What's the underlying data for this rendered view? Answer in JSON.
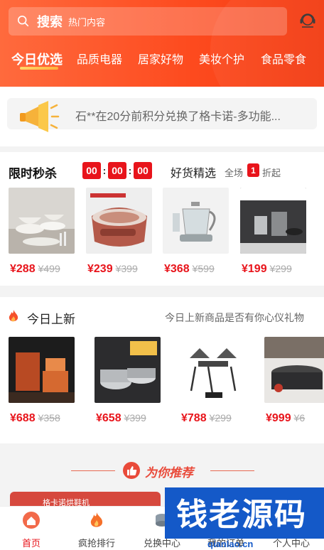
{
  "header": {
    "search_label": "搜索",
    "search_placeholder": "热门内容",
    "tabs": [
      "今日优选",
      "品质电器",
      "居家好物",
      "美妆个护",
      "食品零食"
    ]
  },
  "notice": {
    "text": "石**在20分前积分兑换了格卡诺-多功能..."
  },
  "flash_sale": {
    "title": "限时秒杀",
    "timer": [
      "00",
      "00",
      "00"
    ],
    "timer_sep": ":",
    "good_title": "好货精选",
    "all_label": "全场",
    "fold_badge": "1",
    "fold_label": "折起",
    "products": [
      {
        "now": "¥288",
        "old": "¥499"
      },
      {
        "now": "¥239",
        "old": "¥399"
      },
      {
        "now": "¥368",
        "old": "¥599"
      },
      {
        "now": "¥199",
        "old": "¥299"
      }
    ]
  },
  "new_today": {
    "title": "今日上新",
    "subtitle": "今日上新商品是否有你心仪礼物",
    "products": [
      {
        "now": "¥688",
        "old": "¥358"
      },
      {
        "now": "¥658",
        "old": "¥399"
      },
      {
        "now": "¥788",
        "old": "¥299"
      },
      {
        "now": "¥999",
        "old": "¥6"
      }
    ]
  },
  "recommend": {
    "title": "为你推荐",
    "card_text": "格卡诺烘鞋机"
  },
  "bottom_nav": {
    "items": [
      "首页",
      "疯抢排行",
      "兑换中心",
      "我的订单",
      "个人中心"
    ]
  },
  "watermark": {
    "text": "钱老源码",
    "url": "qianlao.cn"
  },
  "colors": {
    "accent": "#e8141b",
    "header": "#fd4a1e",
    "watermark": "#1459c8"
  }
}
